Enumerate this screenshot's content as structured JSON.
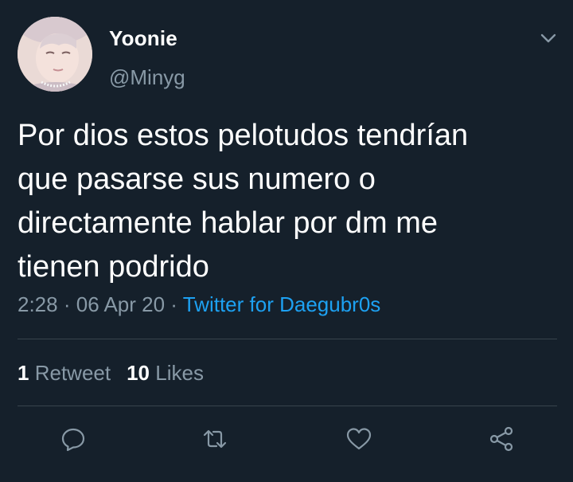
{
  "user": {
    "display_name": "Yoonie",
    "handle": "@Minyg"
  },
  "tweet": {
    "text": "Por dios estos pelotudos tendrían\nque pasarse sus numero o\ndirectamente hablar por dm me\ntienen podrido",
    "time": "2:28",
    "separator": "·",
    "date": "06 Apr 20",
    "source": "Twitter for Daegubr0s"
  },
  "stats": {
    "retweets_count": "1",
    "retweets_label": "Retweet",
    "likes_count": "10",
    "likes_label": "Likes"
  },
  "actions": [
    "reply-icon",
    "retweet-icon",
    "like-icon",
    "share-icon"
  ],
  "colors": {
    "background": "#15202b",
    "primary_text": "#ffffff",
    "secondary_text": "#8899a6",
    "link": "#1da1f2",
    "divider": "#38444d"
  }
}
